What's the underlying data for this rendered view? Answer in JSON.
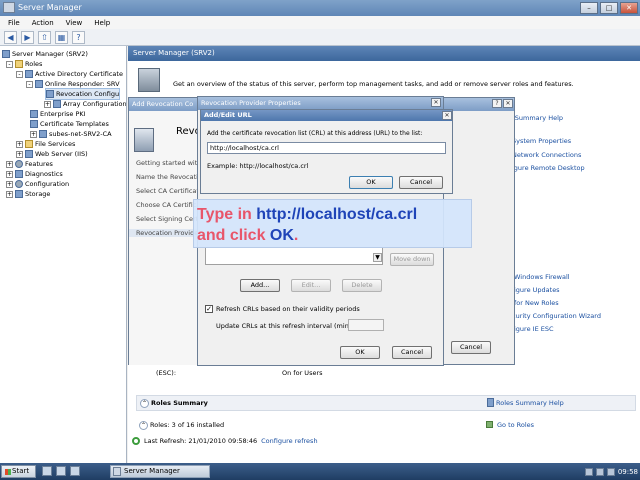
{
  "window": {
    "title": "Server Manager"
  },
  "menu": [
    "File",
    "Action",
    "View",
    "Help"
  ],
  "tree": {
    "root": "Server Manager (SRV2)",
    "roles": "Roles",
    "adcs": "Active Directory Certificate",
    "online_responder": "Online Responder: SRV",
    "revocation_config": "Revocation Configu",
    "array_config": "Array Configuration",
    "enterprise_pki": "Enterprise PKI",
    "cert_templates": "Certificate Templates",
    "subes": "subes-net-SRV2-CA",
    "file_services": "File Services",
    "web_server": "Web Server (IIS)",
    "features": "Features",
    "diagnostics": "Diagnostics",
    "configuration": "Configuration",
    "storage": "Storage"
  },
  "content": {
    "header": "Server Manager (SRV2)",
    "intro": "Get an overview of the status of this server, perform top management tasks, and add or remove server roles and features.",
    "right_links": {
      "summary_help": "r Summary Help",
      "system_props": "System Properties",
      "network_conn": "Network Connections",
      "remote_desktop": "igure Remote Desktop",
      "windows_firewall": "Windows Firewall",
      "updates": "igure Updates",
      "for_new_roles": "for New Roles",
      "security_wizard": "ecurity Configuration Wizard",
      "ie_esc": "igure IE ESC"
    },
    "partial_text": {
      "esses": "esses",
      "der": "der"
    },
    "esc_label": "(ESC):",
    "esc_value": "On for Users",
    "roles_summary": "Roles Summary",
    "roles_summary_help": "Roles Summary Help",
    "roles_count": "Roles:  3 of 16 installed",
    "go_to_roles": "Go to Roles",
    "last_refresh": "Last Refresh: 21/01/2010 09:58:46",
    "configure_refresh": "Configure refresh"
  },
  "wizard": {
    "title": "Add Revocation Co",
    "banner": "Revo",
    "steps": [
      "Getting started with",
      "Name the Revocation",
      "Select CA Certificate",
      "Choose CA Certificate",
      "Select Signing Cert",
      "Revocation Provide"
    ],
    "cancel": "Cancel"
  },
  "props": {
    "title": "Revocation Provider Properties",
    "add": "Add...",
    "edit": "Edit...",
    "delete": "Delete",
    "move_down": "Move down",
    "refresh_label": "Refresh CRLs based on their validity periods",
    "interval_label": "Update CRLs at this refresh interval (min):",
    "ok": "OK",
    "cancel": "Cancel"
  },
  "addurl": {
    "title": "Add/Edit URL",
    "instruction": "Add the certificate revocation list (CRL) at this address (URL) to the list:",
    "value": "http://localhost/ca.crl",
    "example": "Example: http://localhost/ca.crl",
    "ok": "OK",
    "cancel": "Cancel"
  },
  "callout": {
    "part1": "Type in ",
    "url": "http://localhost/ca.crl",
    "part2": "and click ",
    "ok": "OK",
    "period": "."
  },
  "taskbar": {
    "start": "Start",
    "task": "Server Manager",
    "clock": "09:58"
  }
}
